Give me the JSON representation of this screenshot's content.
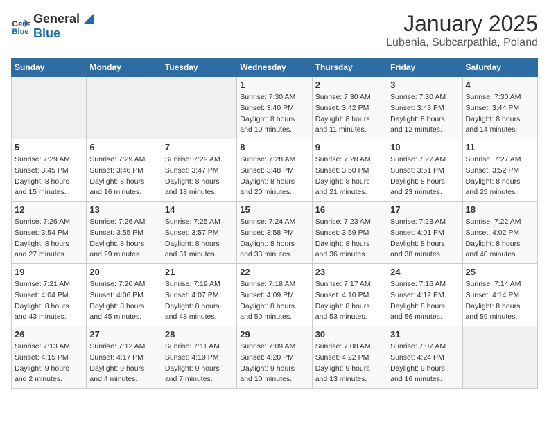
{
  "header": {
    "logo_general": "General",
    "logo_blue": "Blue",
    "title": "January 2025",
    "subtitle": "Lubenia, Subcarpathia, Poland"
  },
  "days_of_week": [
    "Sunday",
    "Monday",
    "Tuesday",
    "Wednesday",
    "Thursday",
    "Friday",
    "Saturday"
  ],
  "weeks": [
    [
      {
        "day": "",
        "info": ""
      },
      {
        "day": "",
        "info": ""
      },
      {
        "day": "",
        "info": ""
      },
      {
        "day": "1",
        "info": "Sunrise: 7:30 AM\nSunset: 3:40 PM\nDaylight: 8 hours\nand 10 minutes."
      },
      {
        "day": "2",
        "info": "Sunrise: 7:30 AM\nSunset: 3:42 PM\nDaylight: 8 hours\nand 11 minutes."
      },
      {
        "day": "3",
        "info": "Sunrise: 7:30 AM\nSunset: 3:43 PM\nDaylight: 8 hours\nand 12 minutes."
      },
      {
        "day": "4",
        "info": "Sunrise: 7:30 AM\nSunset: 3:44 PM\nDaylight: 8 hours\nand 14 minutes."
      }
    ],
    [
      {
        "day": "5",
        "info": "Sunrise: 7:29 AM\nSunset: 3:45 PM\nDaylight: 8 hours\nand 15 minutes."
      },
      {
        "day": "6",
        "info": "Sunrise: 7:29 AM\nSunset: 3:46 PM\nDaylight: 8 hours\nand 16 minutes."
      },
      {
        "day": "7",
        "info": "Sunrise: 7:29 AM\nSunset: 3:47 PM\nDaylight: 8 hours\nand 18 minutes."
      },
      {
        "day": "8",
        "info": "Sunrise: 7:28 AM\nSunset: 3:48 PM\nDaylight: 8 hours\nand 20 minutes."
      },
      {
        "day": "9",
        "info": "Sunrise: 7:28 AM\nSunset: 3:50 PM\nDaylight: 8 hours\nand 21 minutes."
      },
      {
        "day": "10",
        "info": "Sunrise: 7:27 AM\nSunset: 3:51 PM\nDaylight: 8 hours\nand 23 minutes."
      },
      {
        "day": "11",
        "info": "Sunrise: 7:27 AM\nSunset: 3:52 PM\nDaylight: 8 hours\nand 25 minutes."
      }
    ],
    [
      {
        "day": "12",
        "info": "Sunrise: 7:26 AM\nSunset: 3:54 PM\nDaylight: 8 hours\nand 27 minutes."
      },
      {
        "day": "13",
        "info": "Sunrise: 7:26 AM\nSunset: 3:55 PM\nDaylight: 8 hours\nand 29 minutes."
      },
      {
        "day": "14",
        "info": "Sunrise: 7:25 AM\nSunset: 3:57 PM\nDaylight: 8 hours\nand 31 minutes."
      },
      {
        "day": "15",
        "info": "Sunrise: 7:24 AM\nSunset: 3:58 PM\nDaylight: 8 hours\nand 33 minutes."
      },
      {
        "day": "16",
        "info": "Sunrise: 7:23 AM\nSunset: 3:59 PM\nDaylight: 8 hours\nand 36 minutes."
      },
      {
        "day": "17",
        "info": "Sunrise: 7:23 AM\nSunset: 4:01 PM\nDaylight: 8 hours\nand 38 minutes."
      },
      {
        "day": "18",
        "info": "Sunrise: 7:22 AM\nSunset: 4:02 PM\nDaylight: 8 hours\nand 40 minutes."
      }
    ],
    [
      {
        "day": "19",
        "info": "Sunrise: 7:21 AM\nSunset: 4:04 PM\nDaylight: 8 hours\nand 43 minutes."
      },
      {
        "day": "20",
        "info": "Sunrise: 7:20 AM\nSunset: 4:06 PM\nDaylight: 8 hours\nand 45 minutes."
      },
      {
        "day": "21",
        "info": "Sunrise: 7:19 AM\nSunset: 4:07 PM\nDaylight: 8 hours\nand 48 minutes."
      },
      {
        "day": "22",
        "info": "Sunrise: 7:18 AM\nSunset: 4:09 PM\nDaylight: 8 hours\nand 50 minutes."
      },
      {
        "day": "23",
        "info": "Sunrise: 7:17 AM\nSunset: 4:10 PM\nDaylight: 8 hours\nand 53 minutes."
      },
      {
        "day": "24",
        "info": "Sunrise: 7:16 AM\nSunset: 4:12 PM\nDaylight: 8 hours\nand 56 minutes."
      },
      {
        "day": "25",
        "info": "Sunrise: 7:14 AM\nSunset: 4:14 PM\nDaylight: 8 hours\nand 59 minutes."
      }
    ],
    [
      {
        "day": "26",
        "info": "Sunrise: 7:13 AM\nSunset: 4:15 PM\nDaylight: 9 hours\nand 2 minutes."
      },
      {
        "day": "27",
        "info": "Sunrise: 7:12 AM\nSunset: 4:17 PM\nDaylight: 9 hours\nand 4 minutes."
      },
      {
        "day": "28",
        "info": "Sunrise: 7:11 AM\nSunset: 4:19 PM\nDaylight: 9 hours\nand 7 minutes."
      },
      {
        "day": "29",
        "info": "Sunrise: 7:09 AM\nSunset: 4:20 PM\nDaylight: 9 hours\nand 10 minutes."
      },
      {
        "day": "30",
        "info": "Sunrise: 7:08 AM\nSunset: 4:22 PM\nDaylight: 9 hours\nand 13 minutes."
      },
      {
        "day": "31",
        "info": "Sunrise: 7:07 AM\nSunset: 4:24 PM\nDaylight: 9 hours\nand 16 minutes."
      },
      {
        "day": "",
        "info": ""
      }
    ]
  ]
}
